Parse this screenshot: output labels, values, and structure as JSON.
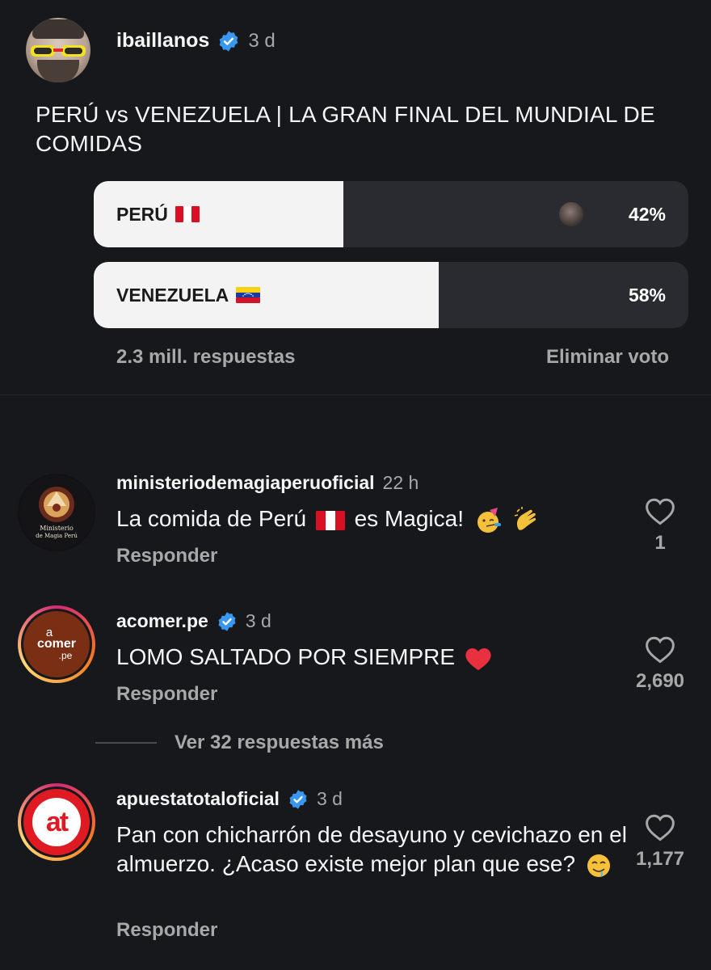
{
  "post": {
    "username": "ibaillanos",
    "time": "3 d",
    "text": "PERÚ vs VENEZUELA | LA GRAN FINAL DEL MUNDIAL DE COMIDAS"
  },
  "poll": {
    "options": [
      {
        "label": "PERÚ",
        "percent_text": "42%",
        "percent": 42
      },
      {
        "label": "VENEZUELA",
        "percent_text": "58%",
        "percent": 58
      }
    ],
    "responses": "2.3 mill. respuestas",
    "remove_vote": "Eliminar voto"
  },
  "comments": [
    {
      "username": "ministeriodemagiaperuoficial",
      "time": "22 h",
      "text_before": "La comida de Perú",
      "text_after": "es Magica!",
      "reply": "Responder",
      "likes": "1",
      "avatar_text_1": "Ministerio",
      "avatar_text_2": "de Magia Perú"
    },
    {
      "username": "acomer.pe",
      "time": "3 d",
      "text": "LOMO SALTADO POR SIEMPRE",
      "reply": "Responder",
      "likes": "2,690",
      "avatar_text_1": "a",
      "avatar_text_2": "comer",
      "avatar_text_3": ".pe"
    },
    {
      "username": "apuestatotaloficial",
      "time": "3 d",
      "text": "Pan con chicharrón de desayuno y cevichazo en el almuerzo. ¿Acaso existe mejor plan que ese?",
      "reply": "Responder",
      "likes": "1,177",
      "avatar_text": "at"
    }
  ],
  "more_replies": "Ver 32 respuestas más",
  "colors": {
    "background": "#17181c",
    "verified": "#3897f0",
    "poll_fill": "#f3f3f3",
    "poll_track": "#2a2b30",
    "secondary_text": "#a8a8a8",
    "heart_red": "#e8303e"
  },
  "icons": [
    "verified-badge-icon",
    "heart-outline-icon",
    "peru-flag-icon",
    "venezuela-flag-icon",
    "party-face-emoji",
    "clapping-hands-emoji",
    "red-heart-emoji",
    "drooling-face-emoji"
  ]
}
